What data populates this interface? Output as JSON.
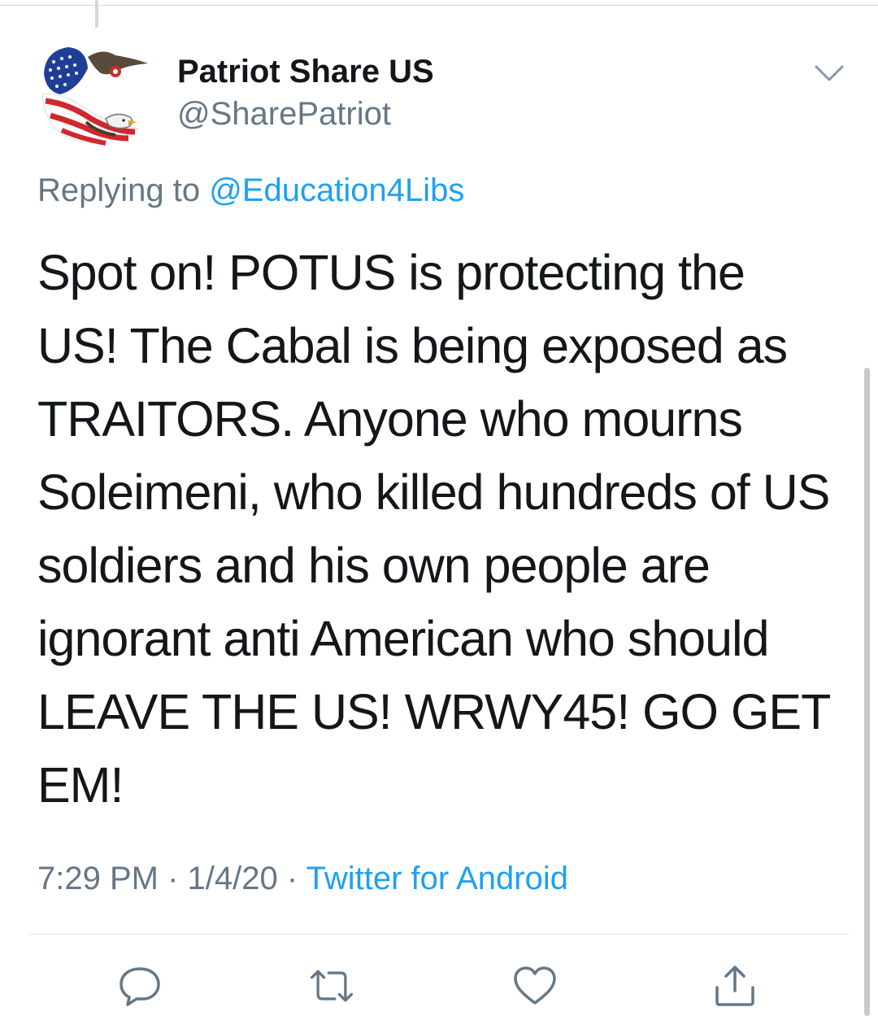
{
  "tweet": {
    "author": {
      "display_name": "Patriot Share US",
      "handle": "@SharePatriot",
      "avatar_icon": "eagle-flag-avatar"
    },
    "replying_to_label": "Replying to",
    "replying_to_handle": "@Education4Libs",
    "text": "Spot on! POTUS is protecting the\nUS! The Cabal is being exposed as\nTRAITORS. Anyone who mourns\nSoleimeni, who killed hundreds of US\nsoldiers and his own people are\nignorant anti American who should\nLEAVE THE US! WRWY45! GO GET\nEM!",
    "time": "7:29 PM",
    "separator": "·",
    "date": "1/4/20",
    "source": "Twitter for Android"
  },
  "actions": [
    {
      "name": "reply",
      "icon": "reply-icon"
    },
    {
      "name": "retweet",
      "icon": "retweet-icon"
    },
    {
      "name": "like",
      "icon": "heart-icon"
    },
    {
      "name": "share",
      "icon": "share-icon"
    }
  ],
  "colors": {
    "text_primary": "#14171a",
    "text_secondary": "#657786",
    "link": "#1da1f2",
    "icon": "#657786"
  }
}
